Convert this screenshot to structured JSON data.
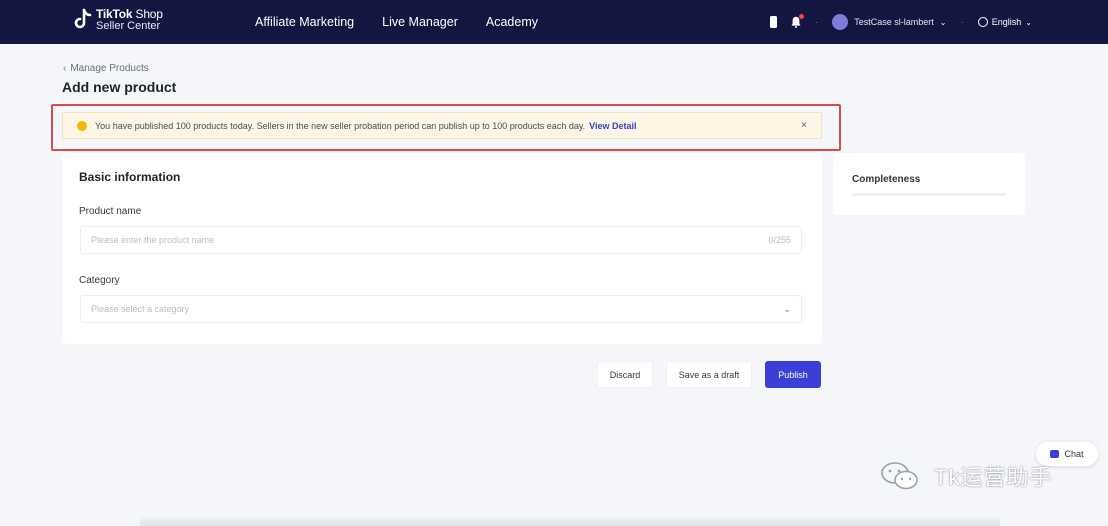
{
  "header": {
    "logo": {
      "line1_bold": "TikTok",
      "line1_rest": " Shop",
      "line2": "Seller Center"
    },
    "nav": [
      "Affiliate Marketing",
      "Live Manager",
      "Academy"
    ],
    "user_name": "TestCase sl-lambert",
    "language": "English"
  },
  "breadcrumb": {
    "back_label": "Manage Products"
  },
  "page_title": "Add new product",
  "banner": {
    "message": "You have published 100 products today. Sellers in the new seller probation period can publish up to 100 products each day.",
    "link": "View Detail",
    "close": "×"
  },
  "basic_info": {
    "title": "Basic information",
    "product_name": {
      "label": "Product name",
      "placeholder": "Please enter the product name",
      "counter": "0/255"
    },
    "category": {
      "label": "Category",
      "placeholder": "Please select a category"
    }
  },
  "completeness": {
    "title": "Completeness",
    "progress": 0
  },
  "actions": {
    "discard": "Discard",
    "save_draft": "Save as a draft",
    "publish": "Publish"
  },
  "chat": {
    "label": "Chat"
  },
  "watermark": {
    "text": "Tk运营助手"
  },
  "colors": {
    "header_bg": "#141642",
    "primary": "#3b3fd8",
    "banner_bg": "#fdf6e7",
    "warning": "#f5b800",
    "highlight_outline": "#d94a4a"
  }
}
